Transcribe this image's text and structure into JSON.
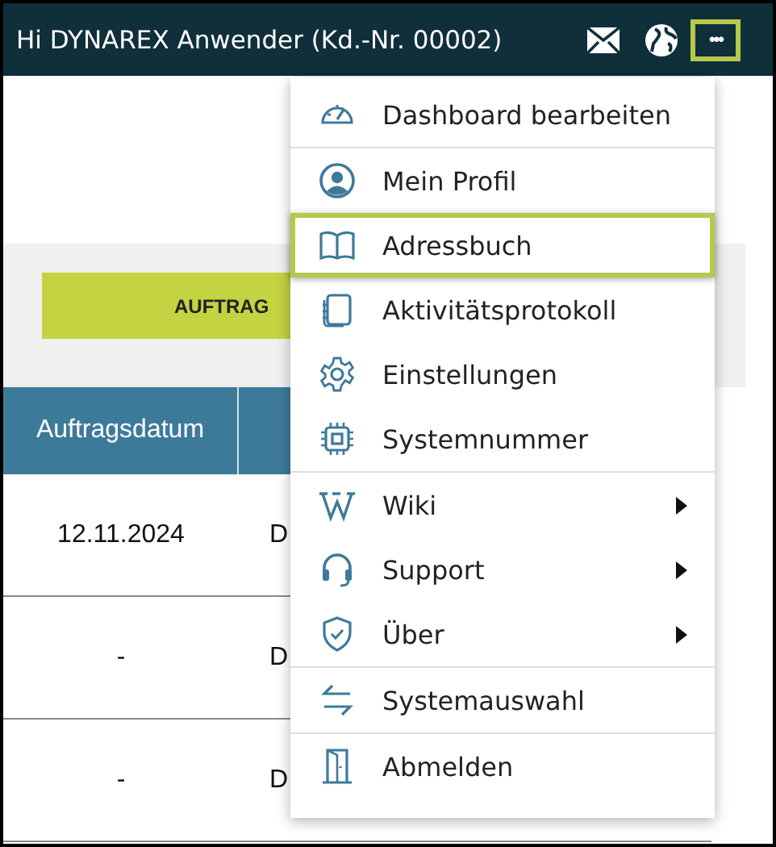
{
  "header": {
    "greeting": "Hi DYNAREX Anwender (Kd.-Nr. 00002)",
    "more_button": {
      "label": "•••",
      "expanded": true
    }
  },
  "action_button": {
    "label": "AUFTRAG"
  },
  "table": {
    "columns": [
      "Auftragsdatum",
      ""
    ],
    "rows": [
      [
        "12.11.2024",
        "D"
      ],
      [
        "-",
        "D"
      ],
      [
        "-",
        "D"
      ]
    ]
  },
  "menu": {
    "groups": [
      [
        {
          "label": "Dashboard bearbeiten",
          "selected": false,
          "submenu": false
        }
      ],
      [
        {
          "label": "Mein Profil",
          "selected": false,
          "submenu": false
        },
        {
          "label": "Adressbuch",
          "selected": true,
          "submenu": false
        },
        {
          "label": "Aktivitätsprotokoll",
          "selected": false,
          "submenu": false
        },
        {
          "label": "Einstellungen",
          "selected": false,
          "submenu": false
        },
        {
          "label": "Systemnummer",
          "selected": false,
          "submenu": false
        }
      ],
      [
        {
          "label": "Wiki",
          "selected": false,
          "submenu": true
        },
        {
          "label": "Support",
          "selected": false,
          "submenu": true
        },
        {
          "label": "Über",
          "selected": false,
          "submenu": true
        }
      ],
      [
        {
          "label": "Systemauswahl",
          "selected": false,
          "submenu": false
        }
      ],
      [
        {
          "label": "Abmelden",
          "selected": false,
          "submenu": false
        }
      ]
    ]
  }
}
